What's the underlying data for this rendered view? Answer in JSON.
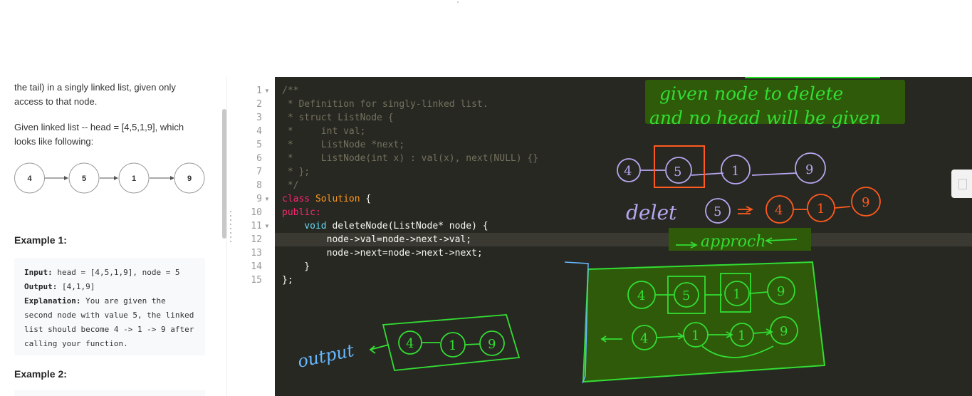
{
  "problem": {
    "text_1": "the tail) in a singly linked list, given only access to that node.",
    "text_2": "Given linked list -- head = [4,5,1,9], which looks like following:",
    "list_nodes": [
      "4",
      "5",
      "1",
      "9"
    ],
    "example1_title": "Example 1:",
    "example1_input_label": "Input:",
    "example1_input_value": " head = [4,5,1,9], node = 5",
    "example1_output_label": "Output:",
    "example1_output_value": " [4,1,9]",
    "example1_expl_label": "Explanation:",
    "example1_expl_value": " You are given the second node with value 5, the linked list should become 4 -> 1 -> 9 after calling your function.",
    "example2_title": "Example 2:"
  },
  "editor": {
    "line_numbers": [
      "1",
      "2",
      "3",
      "4",
      "5",
      "6",
      "7",
      "8",
      "9",
      "10",
      "11",
      "12",
      "13",
      "14",
      "15"
    ],
    "lines": {
      "l1": "/**",
      "l2": " * Definition for singly-linked list.",
      "l3": " * struct ListNode {",
      "l4": " *     int val;",
      "l5": " *     ListNode *next;",
      "l6": " *     ListNode(int x) : val(x), next(NULL) {}",
      "l7": " * };",
      "l8": " */",
      "l9_kw": "class",
      "l9_name": " Solution",
      "l9_rest": " {",
      "l10": "public:",
      "l11_kw": "    void",
      "l11_rest": " deleteNode(ListNode* node) {",
      "l12": "        node->val=node->next->val;",
      "l13": "        node->next=node->next->next;",
      "l14": "    }",
      "l15": "};"
    },
    "active_line": 12
  },
  "annotations": {
    "note1": "given node to delete",
    "note2": "and no head will be given",
    "diagram_nodes": [
      "4",
      "5",
      "1",
      "9"
    ],
    "delete_label": "delet",
    "delete_node": "5",
    "after_nodes": [
      "4",
      "1",
      "9"
    ],
    "approach_label": "approch",
    "box_row1": [
      "4",
      "5",
      "1",
      "9"
    ],
    "box_row2": [
      "4",
      "1",
      "1",
      "9"
    ],
    "output_label": "output",
    "output_nodes": [
      "4",
      "1",
      "9"
    ],
    "colors": {
      "green": "#22cc22",
      "purple": "#b8a6f0",
      "orange": "#ff5a1f",
      "highlight": "#2e5a0a",
      "blue": "#66b8ff",
      "editor_bg": "#272822"
    }
  }
}
